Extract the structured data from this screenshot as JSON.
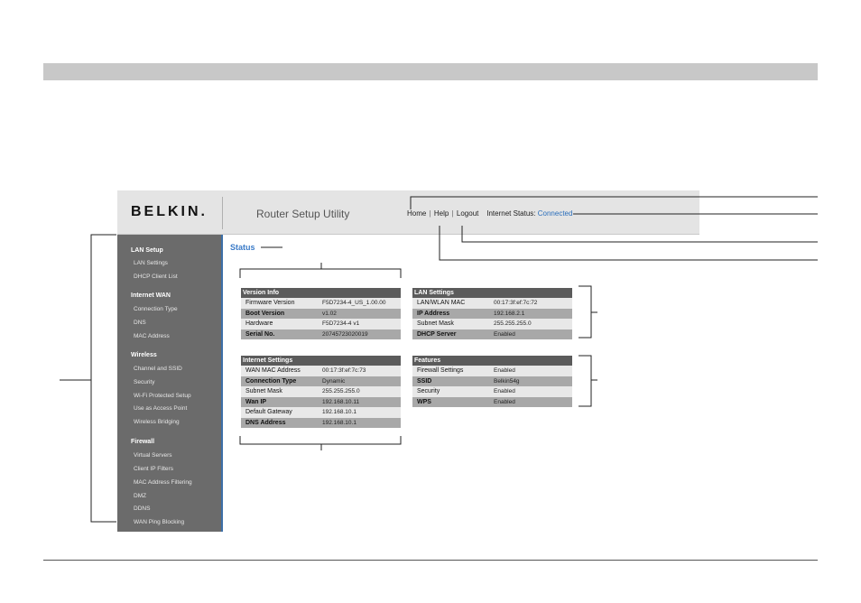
{
  "header": {
    "logo": "BELKIN.",
    "app_title": "Router Setup Utility",
    "nav": {
      "home": "Home",
      "help": "Help",
      "logout": "Logout",
      "sep": "|"
    },
    "internet_status_label": "Internet Status:",
    "internet_status_value": "Connected"
  },
  "sidebar": {
    "sections": [
      {
        "title": "LAN Setup",
        "items": [
          "LAN Settings",
          "DHCP Client List"
        ]
      },
      {
        "title": "Internet WAN",
        "items": [
          "Connection Type",
          "DNS",
          "MAC Address"
        ]
      },
      {
        "title": "Wireless",
        "items": [
          "Channel and SSID",
          "Security",
          "Wi-Fi Protected Setup",
          "Use as Access Point",
          "Wireless Bridging"
        ]
      },
      {
        "title": "Firewall",
        "items": [
          "Virtual Servers",
          "Client IP Filters",
          "MAC Address Filtering",
          "DMZ",
          "DDNS",
          "WAN Ping Blocking"
        ]
      }
    ]
  },
  "main": {
    "title": "Status",
    "version_info": {
      "heading": "Version Info",
      "rows": [
        [
          "Firmware Version",
          "F5D7234-4_US_1.00.00"
        ],
        [
          "Boot Version",
          "v1.02"
        ],
        [
          "Hardware",
          "F5D7234-4 v1"
        ],
        [
          "Serial No.",
          "20745723020019"
        ]
      ]
    },
    "lan_settings": {
      "heading": "LAN Settings",
      "rows": [
        [
          "LAN/WLAN MAC",
          "00:17:3f:ef:7c:72"
        ],
        [
          "IP Address",
          "192.168.2.1"
        ],
        [
          "Subnet Mask",
          "255.255.255.0"
        ],
        [
          "DHCP Server",
          "Enabled"
        ]
      ]
    },
    "internet_settings": {
      "heading": "Internet Settings",
      "rows": [
        [
          "WAN MAC Address",
          "00:17:3f:ef:7c:73"
        ],
        [
          "Connection Type",
          "Dynamic"
        ],
        [
          "Subnet Mask",
          "255.255.255.0"
        ],
        [
          "Wan IP",
          "192.168.10.11"
        ],
        [
          "Default Gateway",
          "192.168.10.1"
        ],
        [
          "DNS Address",
          "192.168.10.1"
        ]
      ]
    },
    "features": {
      "heading": "Features",
      "rows": [
        [
          "Firewall Settings",
          "Enabled"
        ],
        [
          "SSID",
          "Belkin54g"
        ],
        [
          "Security",
          "Enabled"
        ],
        [
          "WPS",
          "Enabled"
        ]
      ]
    }
  },
  "colors": {
    "accent": "#3b7bc8",
    "sidebar": "#6b6b6b",
    "table_header": "#5b5b5b"
  }
}
